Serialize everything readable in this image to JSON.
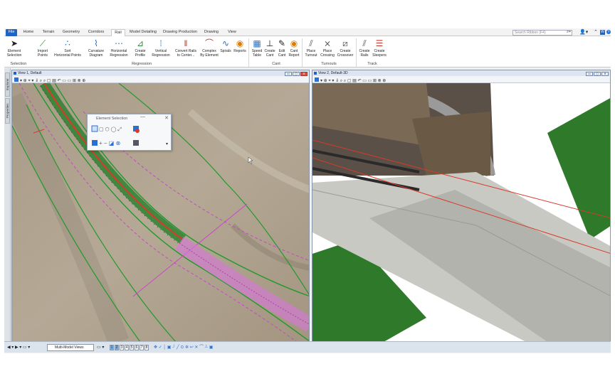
{
  "tabs": [
    "File",
    "Home",
    "Terrain",
    "Geometry",
    "Corridors",
    "Rail",
    "Model Detailing",
    "Drawing Production",
    "Drawing",
    "View"
  ],
  "active_tab": "Rail",
  "search_placeholder": "Search Ribbon (F4)",
  "ribbon": {
    "tools": [
      {
        "label": "Element\nSelection",
        "icon": "arrow-cursor-icon",
        "color": "#111"
      },
      {
        "label": "Import\nPoints",
        "icon": "import-points-icon",
        "color": "#2a8a3a"
      },
      {
        "label": "Sort\nHorizontal Points",
        "icon": "sort-points-icon",
        "color": "#2a6fbd"
      },
      {
        "label": "Curvature\nDiagram",
        "icon": "curvature-icon",
        "color": "#2a6fbd"
      },
      {
        "label": "Horizontal\nRegression",
        "icon": "horizontal-regression-icon",
        "color": "#2a6fbd"
      },
      {
        "label": "Create\nProfile",
        "icon": "create-profile-icon",
        "color": "#2a8a3a"
      },
      {
        "label": "Vertical\nRegression",
        "icon": "vertical-regression-icon",
        "color": "#2a6fbd"
      },
      {
        "label": "Convert Rails\nto Center...",
        "icon": "convert-rails-icon",
        "color": "#c0392b"
      },
      {
        "label": "Complex\nBy Element",
        "icon": "complex-element-icon",
        "color": "#c0392b"
      },
      {
        "label": "Spirals",
        "icon": "spirals-icon",
        "color": "#2a6fbd"
      },
      {
        "label": "Reports",
        "icon": "reports-icon",
        "color": "#e07b00"
      },
      {
        "label": "Speed\nTable",
        "icon": "speed-table-icon",
        "color": "#2a6fbd"
      },
      {
        "label": "Create\nCant",
        "icon": "create-cant-icon",
        "color": "#444"
      },
      {
        "label": "Edit\nCant",
        "icon": "edit-cant-icon",
        "color": "#444"
      },
      {
        "label": "Cant\nReport",
        "icon": "cant-report-icon",
        "color": "#e07b00"
      },
      {
        "label": "Place\nTurnout",
        "icon": "place-turnout-icon",
        "color": "#555"
      },
      {
        "label": "Place\nCrossing",
        "icon": "place-crossing-icon",
        "color": "#555"
      },
      {
        "label": "Create\nCrossover",
        "icon": "create-crossover-icon",
        "color": "#555"
      },
      {
        "label": "Create\nRails",
        "icon": "create-rails-icon",
        "color": "#555"
      },
      {
        "label": "Create\nSleepers",
        "icon": "create-sleepers-icon",
        "color": "#c0392b"
      }
    ],
    "groups": [
      "Selection",
      "Regression",
      "Cant",
      "Turnouts",
      "Track"
    ]
  },
  "side_tabs": [
    "Explorer",
    "Properties"
  ],
  "view1": {
    "title": "View 1, Default",
    "buttons": [
      "▭",
      "▢",
      "✕"
    ]
  },
  "view2": {
    "title": "View 2, Default-3D",
    "buttons": [
      "▭",
      "▢",
      "✕"
    ]
  },
  "dialog": {
    "title": "Element Selection",
    "min": "—",
    "close": "✕"
  },
  "status": {
    "multi_model": "Multi-Model Views",
    "views": [
      "1",
      "2",
      "3",
      "4",
      "5",
      "6",
      "7",
      "8"
    ],
    "active_views": [
      "1",
      "2"
    ]
  },
  "colors": {
    "accent": "#1f64c4",
    "track_red": "#d83a2a",
    "align_green": "#1f9a2a",
    "magenta": "#cc44cc",
    "grass": "#2f7a2a"
  }
}
